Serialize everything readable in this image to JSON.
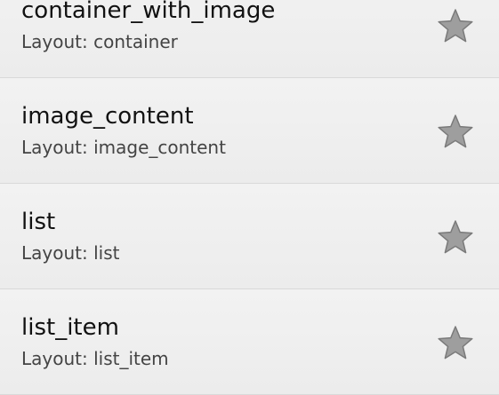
{
  "items": [
    {
      "title": "container_with_image",
      "subtitle": "Layout: container",
      "star_icon": "star-outline-icon",
      "favorited": false
    },
    {
      "title": "image_content",
      "subtitle": "Layout: image_content",
      "star_icon": "star-outline-icon",
      "favorited": false
    },
    {
      "title": "list",
      "subtitle": "Layout: list",
      "star_icon": "star-outline-icon",
      "favorited": false
    },
    {
      "title": "list_item",
      "subtitle": "Layout: list_item",
      "star_icon": "star-outline-icon",
      "favorited": false
    }
  ],
  "colors": {
    "star_fill": "#9e9e9e",
    "star_stroke": "#7a7a7a",
    "divider": "#d9d9d9",
    "background": "#efefef"
  }
}
